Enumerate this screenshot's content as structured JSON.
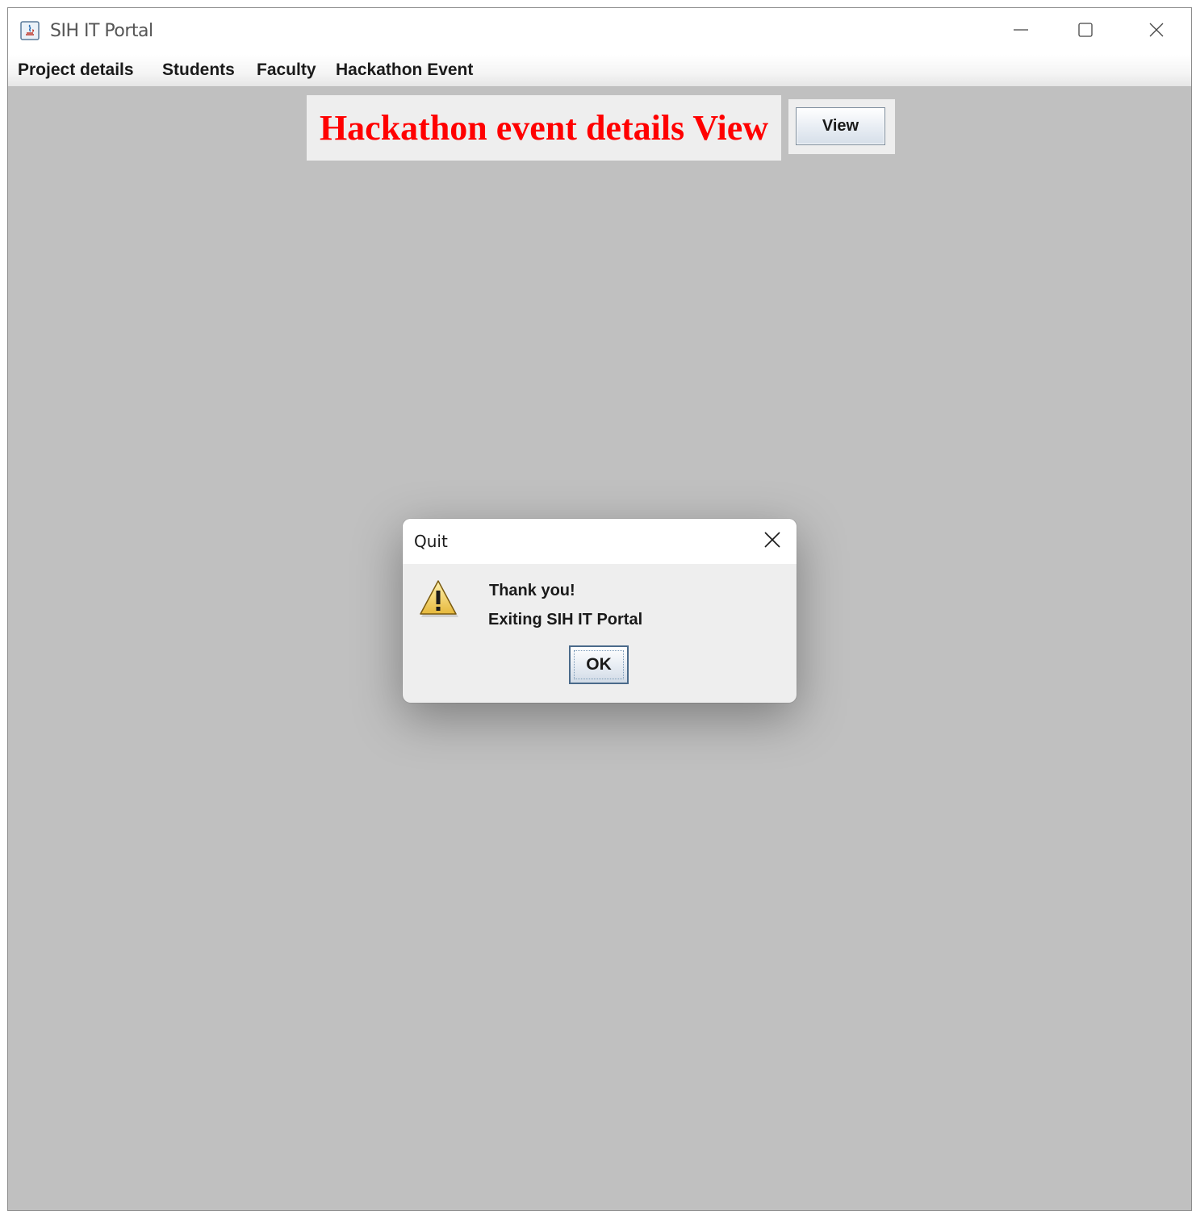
{
  "window": {
    "title": "SIH IT Portal",
    "controls": {
      "minimize_icon": "minimize-icon",
      "maximize_icon": "maximize-icon",
      "close_icon": "close-icon"
    }
  },
  "menubar": {
    "items": [
      {
        "label": "Project details"
      },
      {
        "label": "Students"
      },
      {
        "label": "Faculty"
      },
      {
        "label": "Hackathon Event"
      }
    ]
  },
  "main": {
    "heading": "Hackathon event details View",
    "heading_color": "#ff0000",
    "view_button_label": "View",
    "background_color": "#c0c0c0"
  },
  "dialog": {
    "title": "Quit",
    "icon": "warning-icon",
    "message_line1": "Thank you!",
    "message_line2": "Exiting SIH IT Portal",
    "ok_label": "OK"
  }
}
